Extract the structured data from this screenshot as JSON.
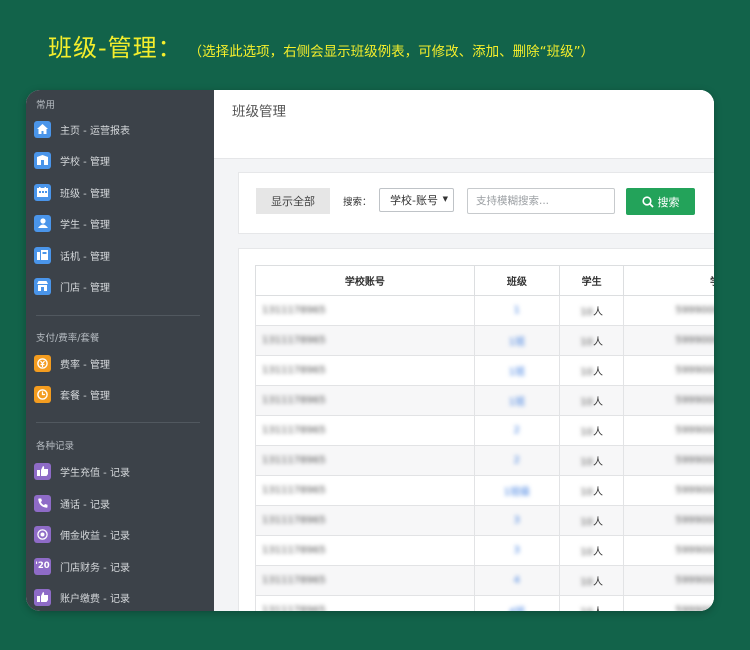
{
  "banner": {
    "title": "班级-管理：",
    "description": "（选择此选项，右侧会显示班级例表，可修改、添加、删除“班级”）"
  },
  "sidebar": {
    "sections": [
      {
        "title": "常用",
        "items": [
          {
            "label": "主页 - 运营报表",
            "icon": "home-icon"
          },
          {
            "label": "学校 - 管理",
            "icon": "school-icon"
          },
          {
            "label": "班级 - 管理",
            "icon": "class-icon"
          },
          {
            "label": "学生 - 管理",
            "icon": "student-icon"
          },
          {
            "label": "话机 - 管理",
            "icon": "phone-device-icon"
          },
          {
            "label": "门店 - 管理",
            "icon": "store-icon"
          }
        ]
      },
      {
        "title": "支付/费率/套餐",
        "items": [
          {
            "label": "费率 - 管理",
            "icon": "rate-icon"
          },
          {
            "label": "套餐 - 管理",
            "icon": "package-icon"
          }
        ]
      },
      {
        "title": "各种记录",
        "items": [
          {
            "label": "学生充值 - 记录",
            "icon": "recharge-icon"
          },
          {
            "label": "通话 - 记录",
            "icon": "call-icon"
          },
          {
            "label": "佣金收益 - 记录",
            "icon": "commission-icon"
          },
          {
            "label": "门店财务 - 记录",
            "icon": "finance-icon",
            "glyph": "'20"
          },
          {
            "label": "账户缴费 - 记录",
            "icon": "payment-icon"
          }
        ]
      }
    ]
  },
  "main": {
    "title": "班级管理",
    "toolbar": {
      "show_all_label": "显示全部",
      "search_label": "搜索：",
      "select_value": "学校-账号",
      "search_placeholder": "支持模糊搜索...",
      "search_button_label": "搜索"
    },
    "table": {
      "columns": [
        "学校账号",
        "班级",
        "学生",
        "学"
      ],
      "rows": [
        {
          "account": "1311178965",
          "class": "1",
          "students": "10",
          "unit": "人",
          "extra": "5999000"
        },
        {
          "account": "1311178965",
          "class": "1班",
          "students": "10",
          "unit": "人",
          "extra": "5999000"
        },
        {
          "account": "1311178965",
          "class": "1班",
          "students": "10",
          "unit": "人",
          "extra": "5999000"
        },
        {
          "account": "1311178965",
          "class": "1班",
          "students": "10",
          "unit": "人",
          "extra": "5999000"
        },
        {
          "account": "1311178965",
          "class": "2",
          "students": "10",
          "unit": "人",
          "extra": "5999000"
        },
        {
          "account": "1311178965",
          "class": "2",
          "students": "10",
          "unit": "人",
          "extra": "5999000"
        },
        {
          "account": "1311178965",
          "class": "1班级",
          "students": "10",
          "unit": "人",
          "extra": "5999000"
        },
        {
          "account": "1311178965",
          "class": "3",
          "students": "10",
          "unit": "人",
          "extra": "5999000"
        },
        {
          "account": "1311178965",
          "class": "3",
          "students": "10",
          "unit": "人",
          "extra": "5999000"
        },
        {
          "account": "1311178965",
          "class": "4",
          "students": "10",
          "unit": "人",
          "extra": "5999000"
        },
        {
          "account": "1311178965",
          "class": "4班",
          "students": "10",
          "unit": "人",
          "extra": "5999000"
        },
        {
          "account": "1311178965",
          "class": "5",
          "students": "10",
          "unit": "人",
          "extra": "5999000"
        }
      ]
    }
  },
  "colors": {
    "background": "#12634a",
    "banner_text": "#f4ee2c",
    "sidebar": "#3c4249",
    "search_button": "#23a35a",
    "icon_blue": "#4a95ea",
    "icon_orange": "#f39c1f",
    "icon_purple": "#8e6bc7"
  }
}
